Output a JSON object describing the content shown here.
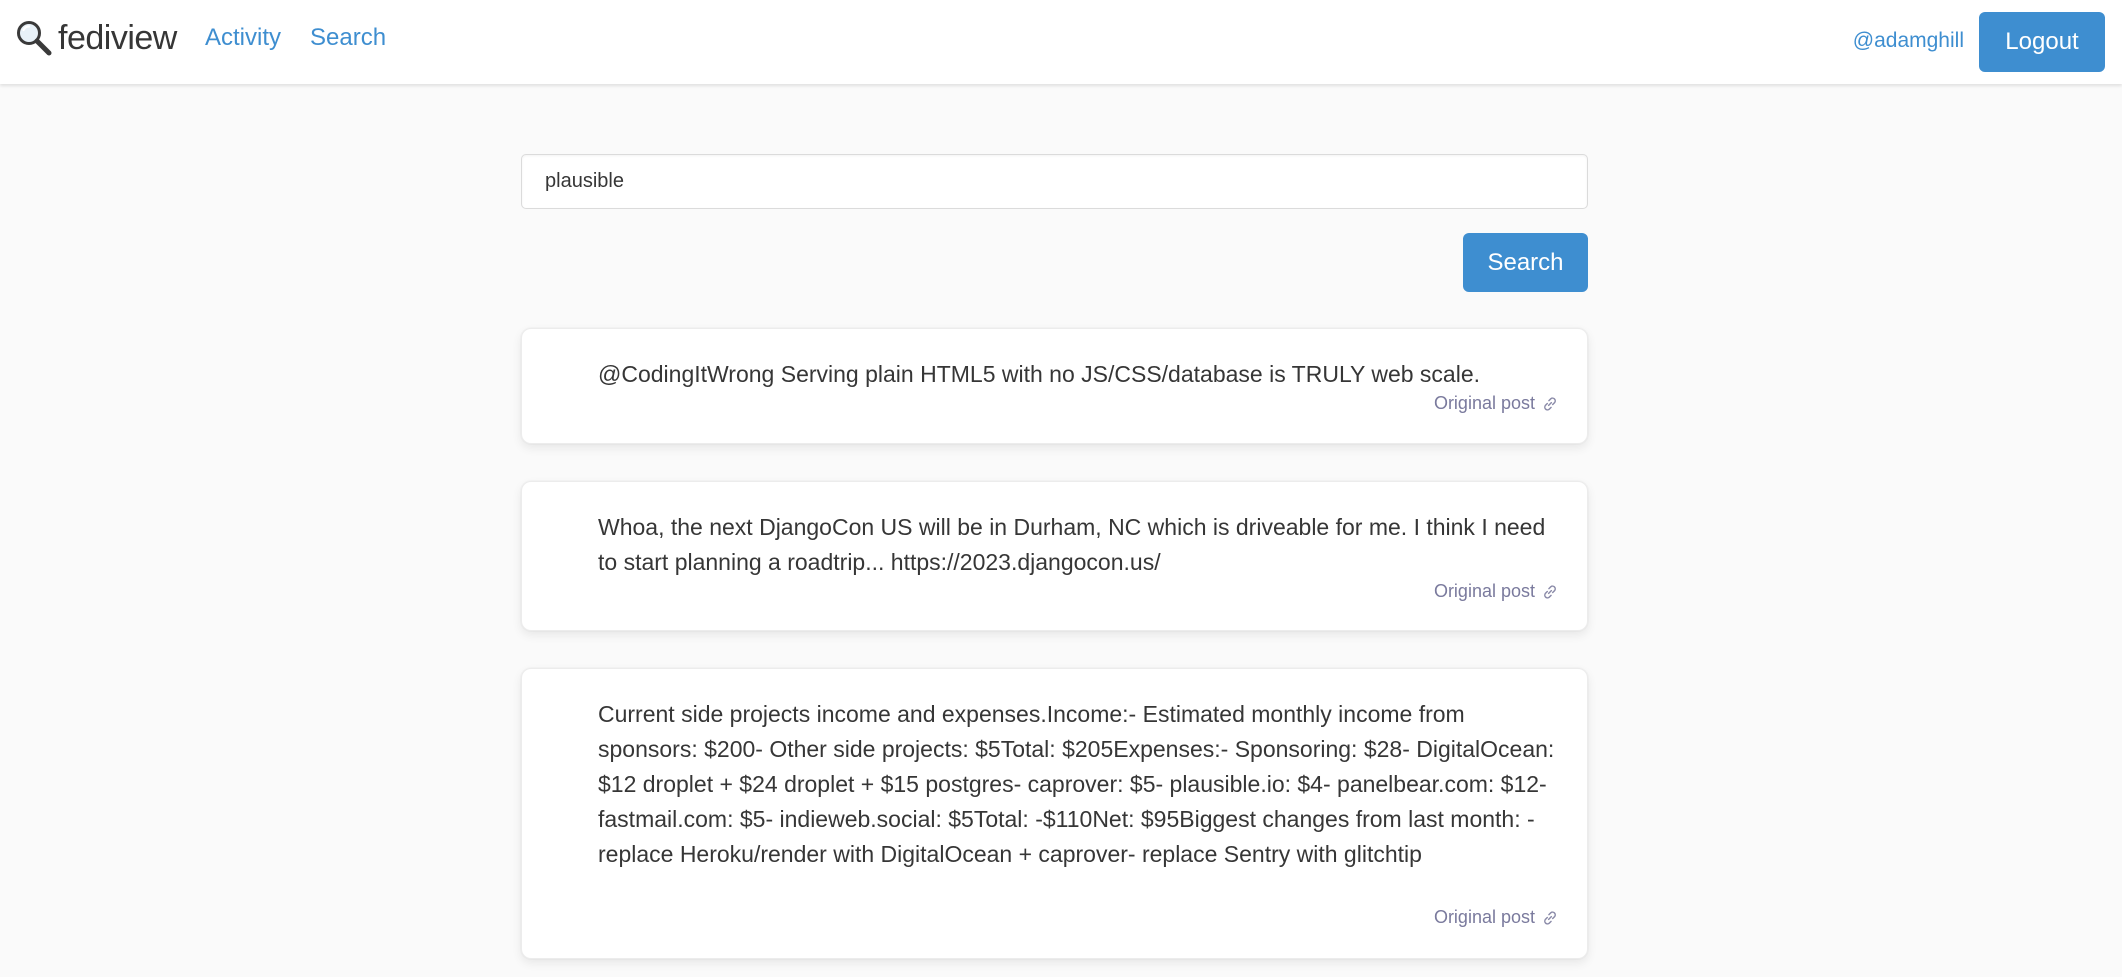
{
  "nav": {
    "brand": "fediview",
    "links": [
      {
        "label": "Activity"
      },
      {
        "label": "Search"
      }
    ],
    "user": "@adamghill",
    "logout_label": "Logout"
  },
  "search": {
    "query": "plausible",
    "button_label": "Search"
  },
  "posts": [
    {
      "content": "@CodingItWrong Serving plain HTML5 with no JS/CSS/database is TRULY web scale.",
      "link_label": "Original post"
    },
    {
      "content": "Whoa, the next DjangoCon US will be in Durham, NC which is driveable for me. I think I need to start planning a roadtrip... https://2023.djangocon.us/",
      "link_label": "Original post"
    },
    {
      "content": "Current side projects income and expenses.Income:- Estimated monthly income from sponsors: $200- Other side projects: $5Total: $205Expenses:- Sponsoring: $28- DigitalOcean: $12 droplet + $24 droplet + $15 postgres- caprover: $5- plausible.io: $4- panelbear.com: $12- fastmail.com: $5- indieweb.social: $5Total: -$110Net: $95Biggest changes from last month: - replace Heroku/render with DigitalOcean + caprover- replace Sentry with glitchtip",
      "link_label": "Original post"
    }
  ],
  "colors": {
    "primary": "#3e8ed0",
    "muted": "#7a7a9d",
    "background": "#fafafa"
  },
  "icons": {
    "brand": "magnifying-glass-icon",
    "original_post": "link-icon"
  }
}
